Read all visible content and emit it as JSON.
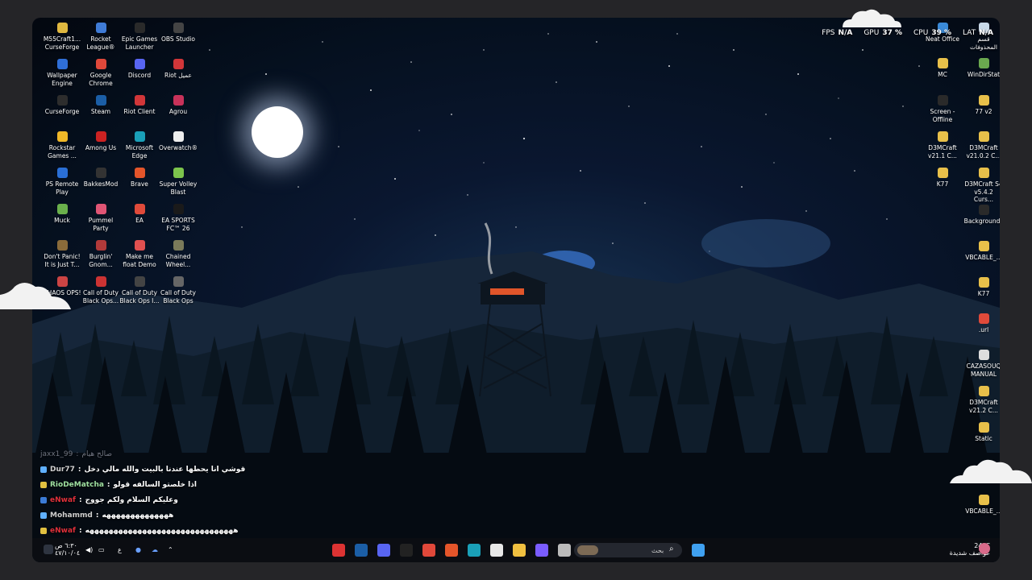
{
  "left_icons": [
    {
      "label": "M55Craft1...\nCurseForge",
      "color": "#e0b840"
    },
    {
      "label": "Rocket\nLeague®",
      "color": "#3f7bd6"
    },
    {
      "label": "Epic Games\nLauncher",
      "color": "#2a2a2a"
    },
    {
      "label": "OBS Studio",
      "color": "#444"
    },
    {
      "label": "Wallpaper\nEngine",
      "color": "#2f6fd8"
    },
    {
      "label": "Google\nChrome",
      "color": "#e0483a"
    },
    {
      "label": "Discord",
      "color": "#5865f2"
    },
    {
      "label": "Riot عميل",
      "color": "#d13639"
    },
    {
      "label": "CurseForge",
      "color": "#2d2d2d"
    },
    {
      "label": "Steam",
      "color": "#1b5ea6"
    },
    {
      "label": "Riot Client",
      "color": "#d13639"
    },
    {
      "label": "Agrou",
      "color": "#c8325a"
    },
    {
      "label": "Rockstar\nGames ...",
      "color": "#f0b828"
    },
    {
      "label": "Among Us",
      "color": "#c22"
    },
    {
      "label": "Microsoft\nEdge",
      "color": "#1aa0b8"
    },
    {
      "label": "Overwatch®",
      "color": "#eeeeee"
    },
    {
      "label": "PS Remote\nPlay",
      "color": "#2a6fd6"
    },
    {
      "label": "BakkesMod",
      "color": "#333"
    },
    {
      "label": "Brave",
      "color": "#e4552a"
    },
    {
      "label": "Super Volley\nBlast",
      "color": "#7cc44c"
    },
    {
      "label": "Muck",
      "color": "#6ab04c"
    },
    {
      "label": "Pummel\nParty",
      "color": "#e05575"
    },
    {
      "label": "EA",
      "color": "#e04a3a"
    },
    {
      "label": "EA SPORTS\nFC™ 26",
      "color": "#1a1a1a"
    },
    {
      "label": "Don't Panic!\nIt is Just T...",
      "color": "#8a6b3a"
    },
    {
      "label": "Burglin'\nGnom...",
      "color": "#b23a3a"
    },
    {
      "label": "Make me\nfloat Demo",
      "color": "#e05050"
    },
    {
      "label": "Chained\nWheel...",
      "color": "#7a7a5a"
    },
    {
      "label": "CHAOS OPS!",
      "color": "#c44"
    },
    {
      "label": "Call of Duty\nBlack Ops...",
      "color": "#c33"
    },
    {
      "label": "Call of Duty\nBlack Ops I...",
      "color": "#444"
    },
    {
      "label": "Call of Duty\nBlack Ops",
      "color": "#666"
    }
  ],
  "right_icons": [
    {
      "label": "Neat Office",
      "color": "#3a8ad8"
    },
    {
      "label": "قسم\nالمحذوفات",
      "color": "#c8d8e8"
    },
    {
      "label": "MC",
      "color": "#e8c04a"
    },
    {
      "label": "WinDirStat",
      "color": "#6aa84f"
    },
    {
      "label": "Screen -\nOffline",
      "color": "#2a2a2a"
    },
    {
      "label": "77 v2",
      "color": "#e8c04a"
    },
    {
      "label": "D3MCraft\nv21.1 C...",
      "color": "#e8c04a"
    },
    {
      "label": "D3MCraft\nv21.0.2 C...",
      "color": "#e8c04a"
    },
    {
      "label": "K77",
      "color": "#e8c04a"
    },
    {
      "label": "D3MCraft S4\nv5.4.2 Curs...",
      "color": "#e8c04a"
    },
    {
      "label": "Backgrounds",
      "color": "#2a2a2a"
    },
    {
      "label": "VBCABLE_...",
      "color": "#e8c04a"
    },
    {
      "label": "K77",
      "color": "#e8c04a"
    },
    {
      "label": ".url",
      "color": "#e04a3a"
    },
    {
      "label": "CAZASOUQ\nMANUAL",
      "color": "#dddddd"
    },
    {
      "label": "D3MCraft\nv21.2 C...",
      "color": "#e8c04a"
    },
    {
      "label": "Static",
      "color": "#e8c04a"
    },
    {
      "label": "VBCABLE_...",
      "color": "#e8c04a"
    }
  ],
  "hud": {
    "fps_label": "FPS",
    "fps_value": "N/A",
    "gpu_label": "GPU",
    "gpu_value": "37 %",
    "cpu_label": "CPU",
    "cpu_value": "39 %",
    "lat_label": "LAT",
    "lat_value": "N/A"
  },
  "chat": [
    {
      "user": "jaxx1_99",
      "sep": ":",
      "msg": "صالح هيام",
      "faded": true,
      "name_color": "#6f7480"
    },
    {
      "user": "Dur77",
      "sep": ":",
      "msg": "قوشي انا يحطها عندنا بالبيت والله مالي دخل",
      "faded": false,
      "name_color": "#cfcfcf"
    },
    {
      "user": "RioDeMatcha",
      "sep": ":",
      "msg": "اذا خلصتو السالفه قولو",
      "faded": false,
      "name_color": "#9fe0a0"
    },
    {
      "user": "eNwaf",
      "sep": ":",
      "msg": "وعليكم السلام ولكم جووج",
      "faded": false,
      "name_color": "#e0303a"
    },
    {
      "user": "Mohammd",
      "sep": ":",
      "msg": "ههههههههههههههه",
      "faded": false,
      "name_color": "#cfcfcf"
    },
    {
      "user": "eNwaf",
      "sep": ":",
      "msg": "هههههههههههههههههههههههههههههههه",
      "faded": false,
      "name_color": "#e0303a"
    }
  ],
  "taskbar": {
    "time": "٦:٣٠ ص",
    "date": "٤٧/١٠/٠٤",
    "lang": "ع",
    "search_placeholder": "بحث",
    "weather_temp": "24°C",
    "weather_desc": "عواصف شديدة",
    "apps": [
      "obs-icon",
      "steam-icon",
      "discord-icon",
      "epic-icon",
      "chrome-icon",
      "brave-icon",
      "edge-icon",
      "store-icon",
      "files-icon",
      "copilot-icon",
      "task-view-icon"
    ]
  },
  "colors": {
    "taskbar_bg": "#0b0d12",
    "page_bg": "#252528"
  }
}
